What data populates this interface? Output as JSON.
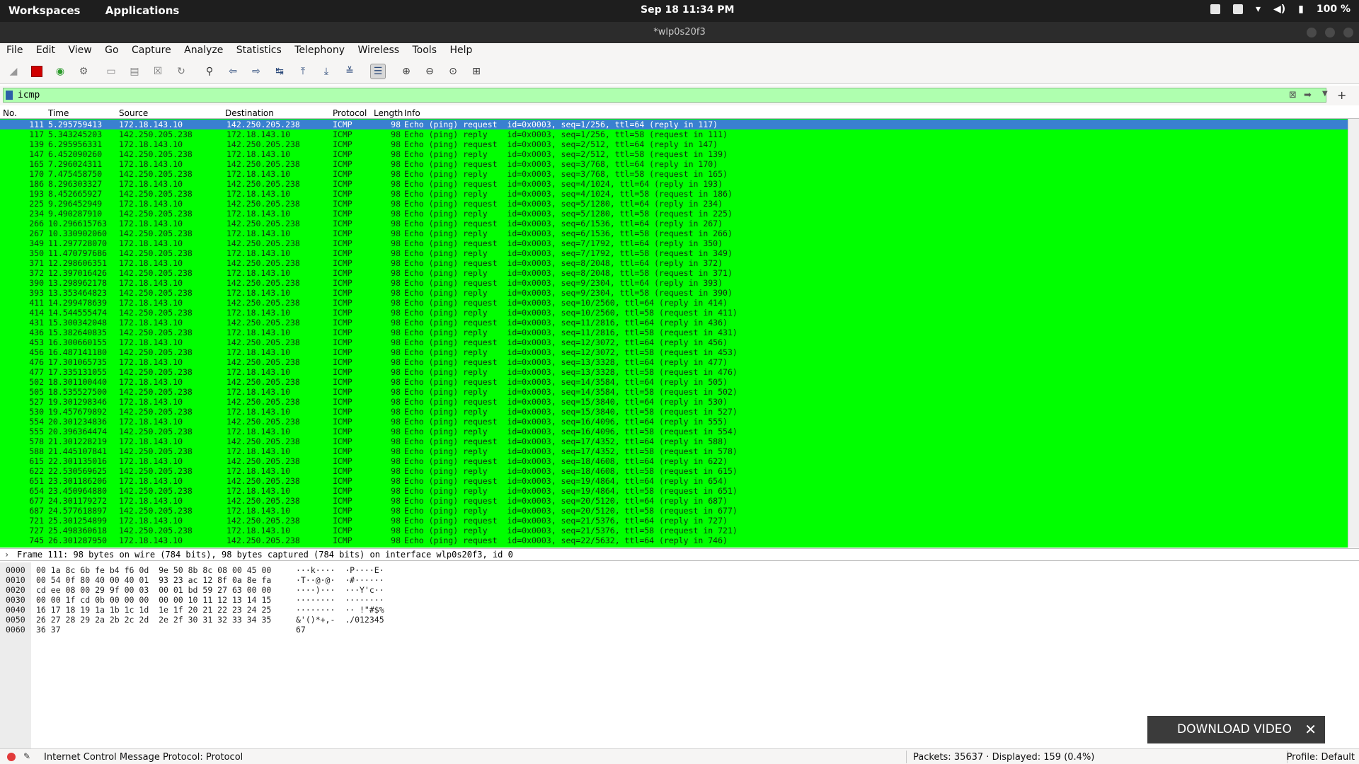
{
  "topbar": {
    "workspaces": "Workspaces",
    "applications": "Applications",
    "clock": "Sep 18  11:34 PM",
    "battery": "100 %"
  },
  "window": {
    "title": "*wlp0s20f3"
  },
  "menu": {
    "file": "File",
    "edit": "Edit",
    "view": "View",
    "go": "Go",
    "capture": "Capture",
    "analyze": "Analyze",
    "statistics": "Statistics",
    "telephony": "Telephony",
    "wireless": "Wireless",
    "tools": "Tools",
    "help": "Help"
  },
  "filter": {
    "value": "icmp"
  },
  "columns": {
    "no": "No.",
    "time": "Time",
    "source": "Source",
    "destination": "Destination",
    "protocol": "Protocol",
    "length": "Length",
    "info": "Info"
  },
  "packets": [
    {
      "no": "111",
      "time": "5.295759413",
      "src": "172.18.143.10",
      "dst": "142.250.205.238",
      "proto": "ICMP",
      "len": "98",
      "info": "Echo (ping) request  id=0x0003, seq=1/256, ttl=64 (reply in 117)"
    },
    {
      "no": "117",
      "time": "5.343245203",
      "src": "142.250.205.238",
      "dst": "172.18.143.10",
      "proto": "ICMP",
      "len": "98",
      "info": "Echo (ping) reply    id=0x0003, seq=1/256, ttl=58 (request in 111)"
    },
    {
      "no": "139",
      "time": "6.295956331",
      "src": "172.18.143.10",
      "dst": "142.250.205.238",
      "proto": "ICMP",
      "len": "98",
      "info": "Echo (ping) request  id=0x0003, seq=2/512, ttl=64 (reply in 147)"
    },
    {
      "no": "147",
      "time": "6.452090260",
      "src": "142.250.205.238",
      "dst": "172.18.143.10",
      "proto": "ICMP",
      "len": "98",
      "info": "Echo (ping) reply    id=0x0003, seq=2/512, ttl=58 (request in 139)"
    },
    {
      "no": "165",
      "time": "7.296024311",
      "src": "172.18.143.10",
      "dst": "142.250.205.238",
      "proto": "ICMP",
      "len": "98",
      "info": "Echo (ping) request  id=0x0003, seq=3/768, ttl=64 (reply in 170)"
    },
    {
      "no": "170",
      "time": "7.475458750",
      "src": "142.250.205.238",
      "dst": "172.18.143.10",
      "proto": "ICMP",
      "len": "98",
      "info": "Echo (ping) reply    id=0x0003, seq=3/768, ttl=58 (request in 165)"
    },
    {
      "no": "186",
      "time": "8.296303327",
      "src": "172.18.143.10",
      "dst": "142.250.205.238",
      "proto": "ICMP",
      "len": "98",
      "info": "Echo (ping) request  id=0x0003, seq=4/1024, ttl=64 (reply in 193)"
    },
    {
      "no": "193",
      "time": "8.452665927",
      "src": "142.250.205.238",
      "dst": "172.18.143.10",
      "proto": "ICMP",
      "len": "98",
      "info": "Echo (ping) reply    id=0x0003, seq=4/1024, ttl=58 (request in 186)"
    },
    {
      "no": "225",
      "time": "9.296452949",
      "src": "172.18.143.10",
      "dst": "142.250.205.238",
      "proto": "ICMP",
      "len": "98",
      "info": "Echo (ping) request  id=0x0003, seq=5/1280, ttl=64 (reply in 234)"
    },
    {
      "no": "234",
      "time": "9.490287910",
      "src": "142.250.205.238",
      "dst": "172.18.143.10",
      "proto": "ICMP",
      "len": "98",
      "info": "Echo (ping) reply    id=0x0003, seq=5/1280, ttl=58 (request in 225)"
    },
    {
      "no": "266",
      "time": "10.296615763",
      "src": "172.18.143.10",
      "dst": "142.250.205.238",
      "proto": "ICMP",
      "len": "98",
      "info": "Echo (ping) request  id=0x0003, seq=6/1536, ttl=64 (reply in 267)"
    },
    {
      "no": "267",
      "time": "10.330902060",
      "src": "142.250.205.238",
      "dst": "172.18.143.10",
      "proto": "ICMP",
      "len": "98",
      "info": "Echo (ping) reply    id=0x0003, seq=6/1536, ttl=58 (request in 266)"
    },
    {
      "no": "349",
      "time": "11.297728070",
      "src": "172.18.143.10",
      "dst": "142.250.205.238",
      "proto": "ICMP",
      "len": "98",
      "info": "Echo (ping) request  id=0x0003, seq=7/1792, ttl=64 (reply in 350)"
    },
    {
      "no": "350",
      "time": "11.470797686",
      "src": "142.250.205.238",
      "dst": "172.18.143.10",
      "proto": "ICMP",
      "len": "98",
      "info": "Echo (ping) reply    id=0x0003, seq=7/1792, ttl=58 (request in 349)"
    },
    {
      "no": "371",
      "time": "12.298606351",
      "src": "172.18.143.10",
      "dst": "142.250.205.238",
      "proto": "ICMP",
      "len": "98",
      "info": "Echo (ping) request  id=0x0003, seq=8/2048, ttl=64 (reply in 372)"
    },
    {
      "no": "372",
      "time": "12.397016426",
      "src": "142.250.205.238",
      "dst": "172.18.143.10",
      "proto": "ICMP",
      "len": "98",
      "info": "Echo (ping) reply    id=0x0003, seq=8/2048, ttl=58 (request in 371)"
    },
    {
      "no": "390",
      "time": "13.298962178",
      "src": "172.18.143.10",
      "dst": "142.250.205.238",
      "proto": "ICMP",
      "len": "98",
      "info": "Echo (ping) request  id=0x0003, seq=9/2304, ttl=64 (reply in 393)"
    },
    {
      "no": "393",
      "time": "13.353464823",
      "src": "142.250.205.238",
      "dst": "172.18.143.10",
      "proto": "ICMP",
      "len": "98",
      "info": "Echo (ping) reply    id=0x0003, seq=9/2304, ttl=58 (request in 390)"
    },
    {
      "no": "411",
      "time": "14.299478639",
      "src": "172.18.143.10",
      "dst": "142.250.205.238",
      "proto": "ICMP",
      "len": "98",
      "info": "Echo (ping) request  id=0x0003, seq=10/2560, ttl=64 (reply in 414)"
    },
    {
      "no": "414",
      "time": "14.544555474",
      "src": "142.250.205.238",
      "dst": "172.18.143.10",
      "proto": "ICMP",
      "len": "98",
      "info": "Echo (ping) reply    id=0x0003, seq=10/2560, ttl=58 (request in 411)"
    },
    {
      "no": "431",
      "time": "15.300342048",
      "src": "172.18.143.10",
      "dst": "142.250.205.238",
      "proto": "ICMP",
      "len": "98",
      "info": "Echo (ping) request  id=0x0003, seq=11/2816, ttl=64 (reply in 436)"
    },
    {
      "no": "436",
      "time": "15.382640835",
      "src": "142.250.205.238",
      "dst": "172.18.143.10",
      "proto": "ICMP",
      "len": "98",
      "info": "Echo (ping) reply    id=0x0003, seq=11/2816, ttl=58 (request in 431)"
    },
    {
      "no": "453",
      "time": "16.300660155",
      "src": "172.18.143.10",
      "dst": "142.250.205.238",
      "proto": "ICMP",
      "len": "98",
      "info": "Echo (ping) request  id=0x0003, seq=12/3072, ttl=64 (reply in 456)"
    },
    {
      "no": "456",
      "time": "16.487141180",
      "src": "142.250.205.238",
      "dst": "172.18.143.10",
      "proto": "ICMP",
      "len": "98",
      "info": "Echo (ping) reply    id=0x0003, seq=12/3072, ttl=58 (request in 453)"
    },
    {
      "no": "476",
      "time": "17.301065735",
      "src": "172.18.143.10",
      "dst": "142.250.205.238",
      "proto": "ICMP",
      "len": "98",
      "info": "Echo (ping) request  id=0x0003, seq=13/3328, ttl=64 (reply in 477)"
    },
    {
      "no": "477",
      "time": "17.335131055",
      "src": "142.250.205.238",
      "dst": "172.18.143.10",
      "proto": "ICMP",
      "len": "98",
      "info": "Echo (ping) reply    id=0x0003, seq=13/3328, ttl=58 (request in 476)"
    },
    {
      "no": "502",
      "time": "18.301100440",
      "src": "172.18.143.10",
      "dst": "142.250.205.238",
      "proto": "ICMP",
      "len": "98",
      "info": "Echo (ping) request  id=0x0003, seq=14/3584, ttl=64 (reply in 505)"
    },
    {
      "no": "505",
      "time": "18.535527500",
      "src": "142.250.205.238",
      "dst": "172.18.143.10",
      "proto": "ICMP",
      "len": "98",
      "info": "Echo (ping) reply    id=0x0003, seq=14/3584, ttl=58 (request in 502)"
    },
    {
      "no": "527",
      "time": "19.301298346",
      "src": "172.18.143.10",
      "dst": "142.250.205.238",
      "proto": "ICMP",
      "len": "98",
      "info": "Echo (ping) request  id=0x0003, seq=15/3840, ttl=64 (reply in 530)"
    },
    {
      "no": "530",
      "time": "19.457679892",
      "src": "142.250.205.238",
      "dst": "172.18.143.10",
      "proto": "ICMP",
      "len": "98",
      "info": "Echo (ping) reply    id=0x0003, seq=15/3840, ttl=58 (request in 527)"
    },
    {
      "no": "554",
      "time": "20.301234836",
      "src": "172.18.143.10",
      "dst": "142.250.205.238",
      "proto": "ICMP",
      "len": "98",
      "info": "Echo (ping) request  id=0x0003, seq=16/4096, ttl=64 (reply in 555)"
    },
    {
      "no": "555",
      "time": "20.396364474",
      "src": "142.250.205.238",
      "dst": "172.18.143.10",
      "proto": "ICMP",
      "len": "98",
      "info": "Echo (ping) reply    id=0x0003, seq=16/4096, ttl=58 (request in 554)"
    },
    {
      "no": "578",
      "time": "21.301228219",
      "src": "172.18.143.10",
      "dst": "142.250.205.238",
      "proto": "ICMP",
      "len": "98",
      "info": "Echo (ping) request  id=0x0003, seq=17/4352, ttl=64 (reply in 588)"
    },
    {
      "no": "588",
      "time": "21.445107841",
      "src": "142.250.205.238",
      "dst": "172.18.143.10",
      "proto": "ICMP",
      "len": "98",
      "info": "Echo (ping) reply    id=0x0003, seq=17/4352, ttl=58 (request in 578)"
    },
    {
      "no": "615",
      "time": "22.301135016",
      "src": "172.18.143.10",
      "dst": "142.250.205.238",
      "proto": "ICMP",
      "len": "98",
      "info": "Echo (ping) request  id=0x0003, seq=18/4608, ttl=64 (reply in 622)"
    },
    {
      "no": "622",
      "time": "22.530569625",
      "src": "142.250.205.238",
      "dst": "172.18.143.10",
      "proto": "ICMP",
      "len": "98",
      "info": "Echo (ping) reply    id=0x0003, seq=18/4608, ttl=58 (request in 615)"
    },
    {
      "no": "651",
      "time": "23.301186206",
      "src": "172.18.143.10",
      "dst": "142.250.205.238",
      "proto": "ICMP",
      "len": "98",
      "info": "Echo (ping) request  id=0x0003, seq=19/4864, ttl=64 (reply in 654)"
    },
    {
      "no": "654",
      "time": "23.450964880",
      "src": "142.250.205.238",
      "dst": "172.18.143.10",
      "proto": "ICMP",
      "len": "98",
      "info": "Echo (ping) reply    id=0x0003, seq=19/4864, ttl=58 (request in 651)"
    },
    {
      "no": "677",
      "time": "24.301179272",
      "src": "172.18.143.10",
      "dst": "142.250.205.238",
      "proto": "ICMP",
      "len": "98",
      "info": "Echo (ping) request  id=0x0003, seq=20/5120, ttl=64 (reply in 687)"
    },
    {
      "no": "687",
      "time": "24.577618897",
      "src": "142.250.205.238",
      "dst": "172.18.143.10",
      "proto": "ICMP",
      "len": "98",
      "info": "Echo (ping) reply    id=0x0003, seq=20/5120, ttl=58 (request in 677)"
    },
    {
      "no": "721",
      "time": "25.301254899",
      "src": "172.18.143.10",
      "dst": "142.250.205.238",
      "proto": "ICMP",
      "len": "98",
      "info": "Echo (ping) request  id=0x0003, seq=21/5376, ttl=64 (reply in 727)"
    },
    {
      "no": "727",
      "time": "25.498360618",
      "src": "142.250.205.238",
      "dst": "172.18.143.10",
      "proto": "ICMP",
      "len": "98",
      "info": "Echo (ping) reply    id=0x0003, seq=21/5376, ttl=58 (request in 721)"
    },
    {
      "no": "745",
      "time": "26.301287950",
      "src": "172.18.143.10",
      "dst": "142.250.205.238",
      "proto": "ICMP",
      "len": "98",
      "info": "Echo (ping) request  id=0x0003, seq=22/5632, ttl=64 (reply in 746)"
    }
  ],
  "detail": {
    "frame": "Frame 111: 98 bytes on wire (784 bits), 98 bytes captured (784 bits) on interface wlp0s20f3, id 0"
  },
  "bytes": [
    {
      "off": "0000",
      "hex": "00 1a 8c 6b fe b4 f6 0d  9e 50 8b 8c 08 00 45 00",
      "asc": "···k····  ·P····E·"
    },
    {
      "off": "0010",
      "hex": "00 54 0f 80 40 00 40 01  93 23 ac 12 8f 0a 8e fa",
      "asc": "·T··@·@·  ·#······"
    },
    {
      "off": "0020",
      "hex": "cd ee 08 00 29 9f 00 03  00 01 bd 59 27 63 00 00",
      "asc": "····)···  ···Y'c··"
    },
    {
      "off": "0030",
      "hex": "00 00 1f cd 0b 00 00 00  00 00 10 11 12 13 14 15",
      "asc": "········  ········"
    },
    {
      "off": "0040",
      "hex": "16 17 18 19 1a 1b 1c 1d  1e 1f 20 21 22 23 24 25",
      "asc": "········  ·· !\"#$%"
    },
    {
      "off": "0050",
      "hex": "26 27 28 29 2a 2b 2c 2d  2e 2f 30 31 32 33 34 35",
      "asc": "&'()*+,-  ./012345"
    },
    {
      "off": "0060",
      "hex": "36 37",
      "asc": "67"
    }
  ],
  "download": {
    "label": "DOWNLOAD VIDEO",
    "close": "✕"
  },
  "status": {
    "message": "Internet Control Message Protocol: Protocol",
    "packets": "Packets: 35637 · Displayed: 159 (0.4%)",
    "profile": "Profile: Default"
  },
  "colors": {
    "row_bg": "#00ff00",
    "selected": "#3a80d0",
    "filter_bg": "#afffaf"
  }
}
